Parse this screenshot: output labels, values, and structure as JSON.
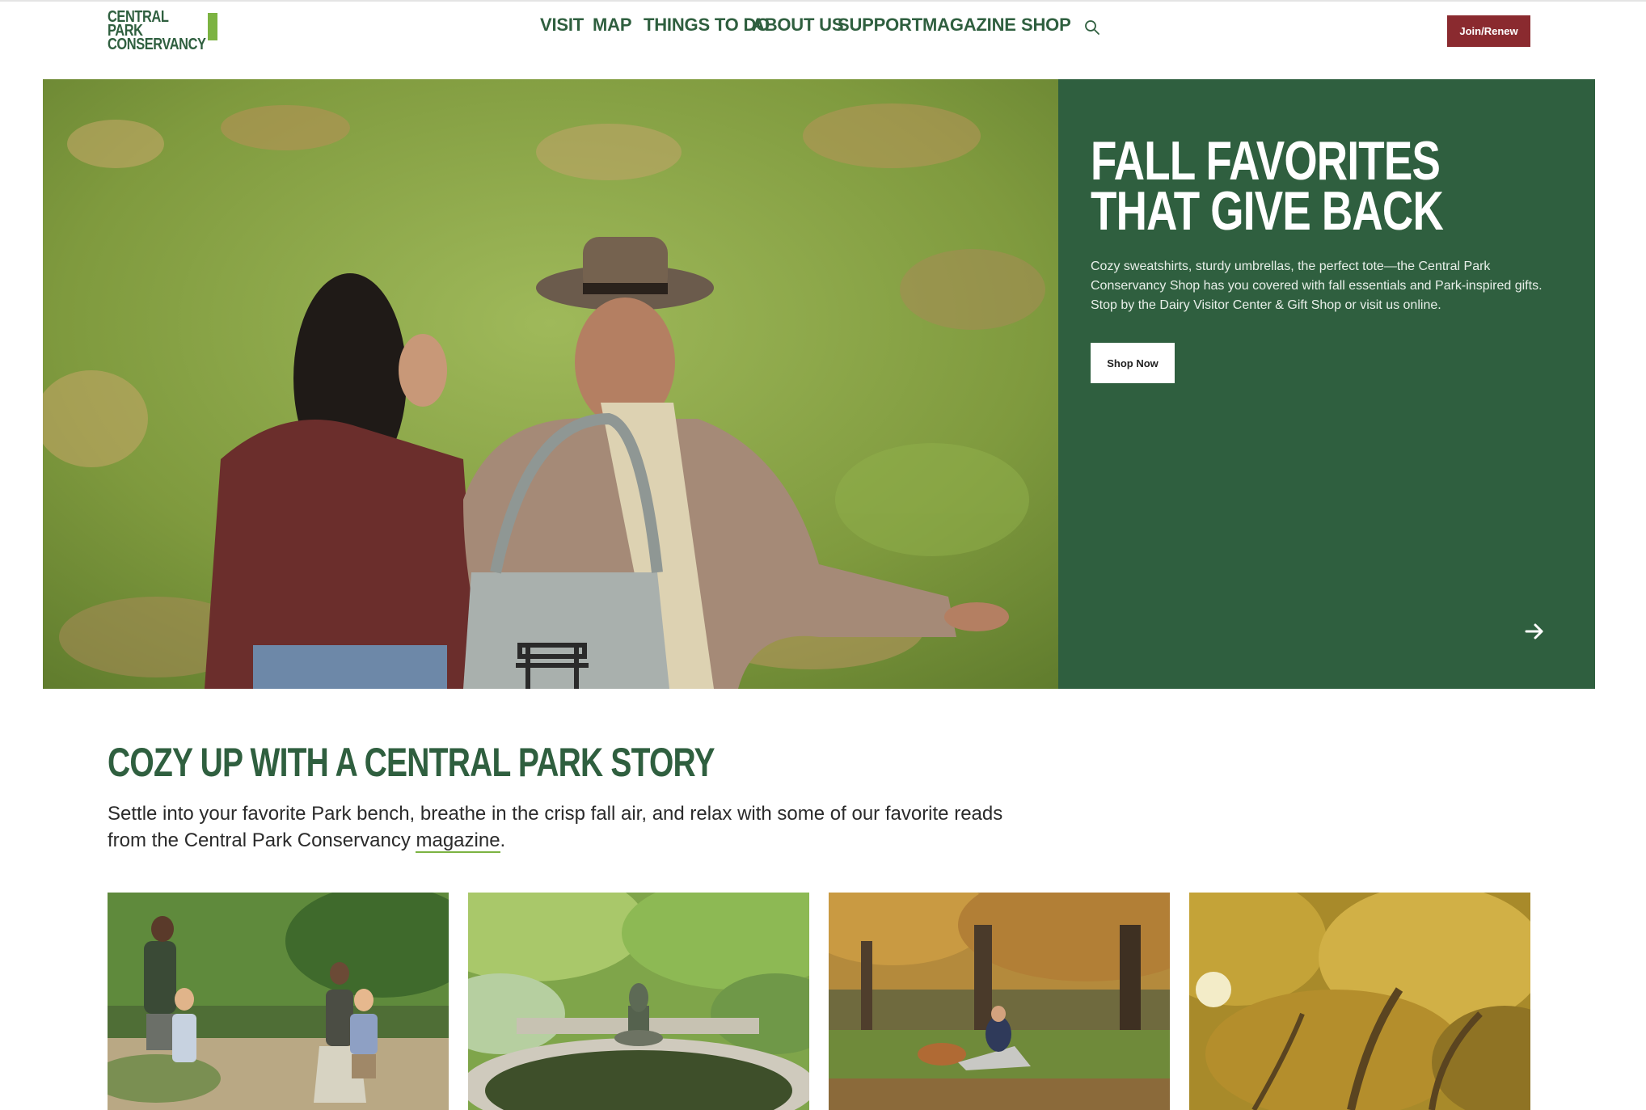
{
  "header": {
    "logo": {
      "line1": "CENTRAL PARK",
      "line2": "CONSERVANCY"
    },
    "nav": [
      "VISIT",
      "MAP",
      "THINGS TO DO",
      "ABOUT US",
      "SUPPORT",
      "MAGAZINE",
      "SHOP"
    ],
    "search_icon": "search-icon",
    "join_label": "Join/Renew"
  },
  "hero": {
    "title": "FALL FAVORITES THAT GIVE BACK",
    "body": "Cozy sweatshirts, sturdy umbrellas, the perfect tote—the Central Park Conservancy Shop has you covered with fall essentials and Park-inspired gifts. Stop by the Dairy Visitor Center & Gift Shop or visit us online.",
    "cta_label": "Shop Now",
    "next_icon": "arrow-right-icon"
  },
  "stories": {
    "title": "COZY UP WITH A CENTRAL PARK STORY",
    "intro_before": "Settle into your favorite Park bench, breathe in the crisp fall air, and relax with some of our favorite reads from the Central Park Conservancy ",
    "intro_link": "magazine",
    "intro_after": ".",
    "cards": [
      {
        "image": "family-playing-photo"
      },
      {
        "image": "garden-fountain-photo"
      },
      {
        "image": "person-with-dog-photo"
      },
      {
        "image": "autumn-canopy-photo"
      }
    ]
  },
  "colors": {
    "brand_green": "#2f5f3f",
    "accent_green": "#7cb342",
    "join_red": "#8a2a2f"
  }
}
